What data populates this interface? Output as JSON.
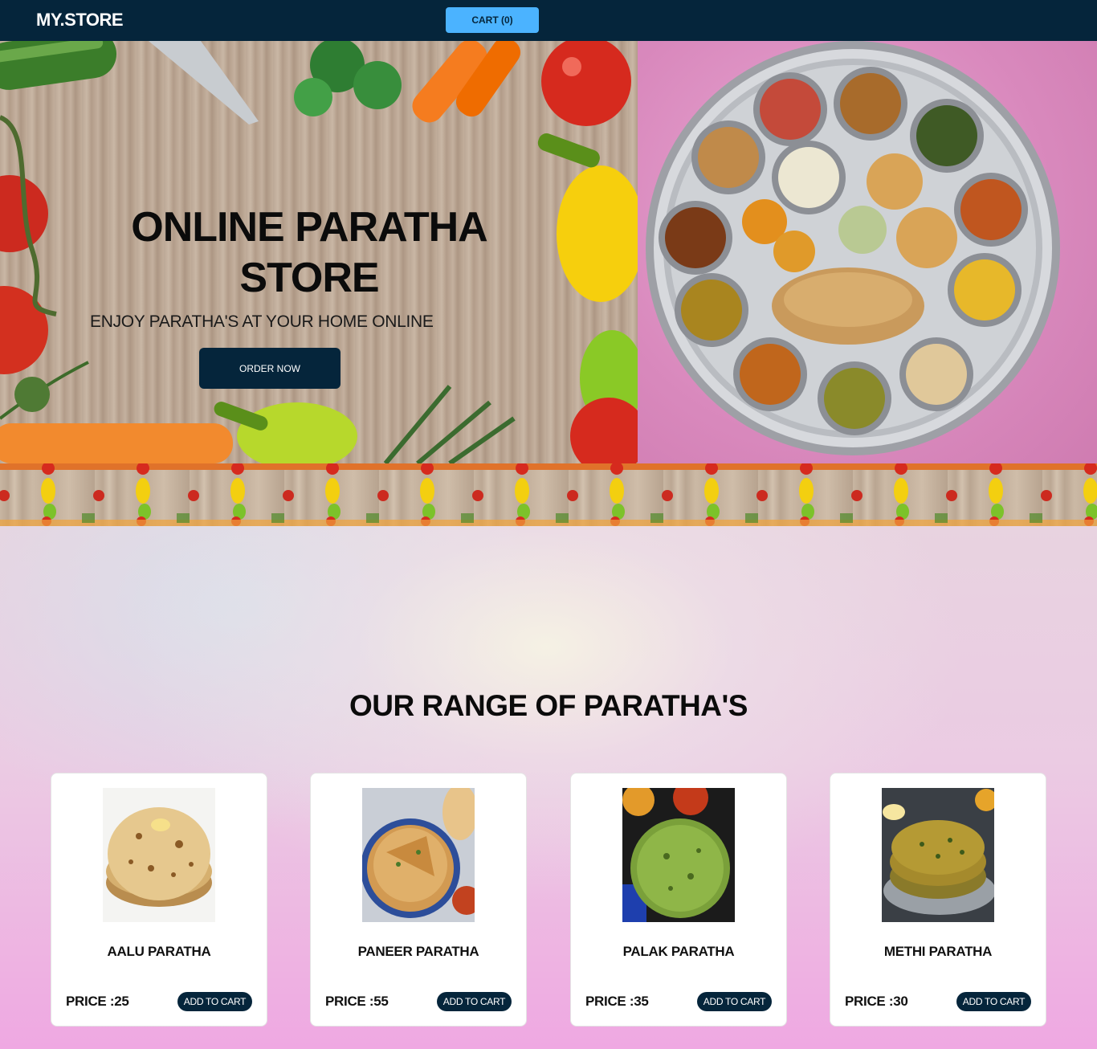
{
  "nav": {
    "logo": "MY.STORE",
    "cart_label": "CART (0)"
  },
  "hero": {
    "title": "ONLINE PARATHA STORE",
    "subtitle": "ENJOY PARATHA'S AT YOUR HOME ONLINE",
    "order_label": "ORDER NOW"
  },
  "range": {
    "title": "OUR RANGE OF PARATHA'S",
    "products": [
      {
        "name": "AALU PARATHA",
        "price": "PRICE :25",
        "button": "ADD TO CART",
        "image": "aalu-paratha-image"
      },
      {
        "name": "PANEER PARATHA",
        "price": "PRICE :55",
        "button": "ADD TO CART",
        "image": "paneer-paratha-image"
      },
      {
        "name": "PALAK PARATHA",
        "price": "PRICE :35",
        "button": "ADD TO CART",
        "image": "palak-paratha-image"
      },
      {
        "name": "METHI PARATHA",
        "price": "PRICE :30",
        "button": "ADD TO CART",
        "image": "methi-paratha-image"
      }
    ]
  },
  "colors": {
    "navy": "#05253b",
    "cart_blue": "#4bb3ff",
    "pink_bg": "#efa8e2"
  }
}
